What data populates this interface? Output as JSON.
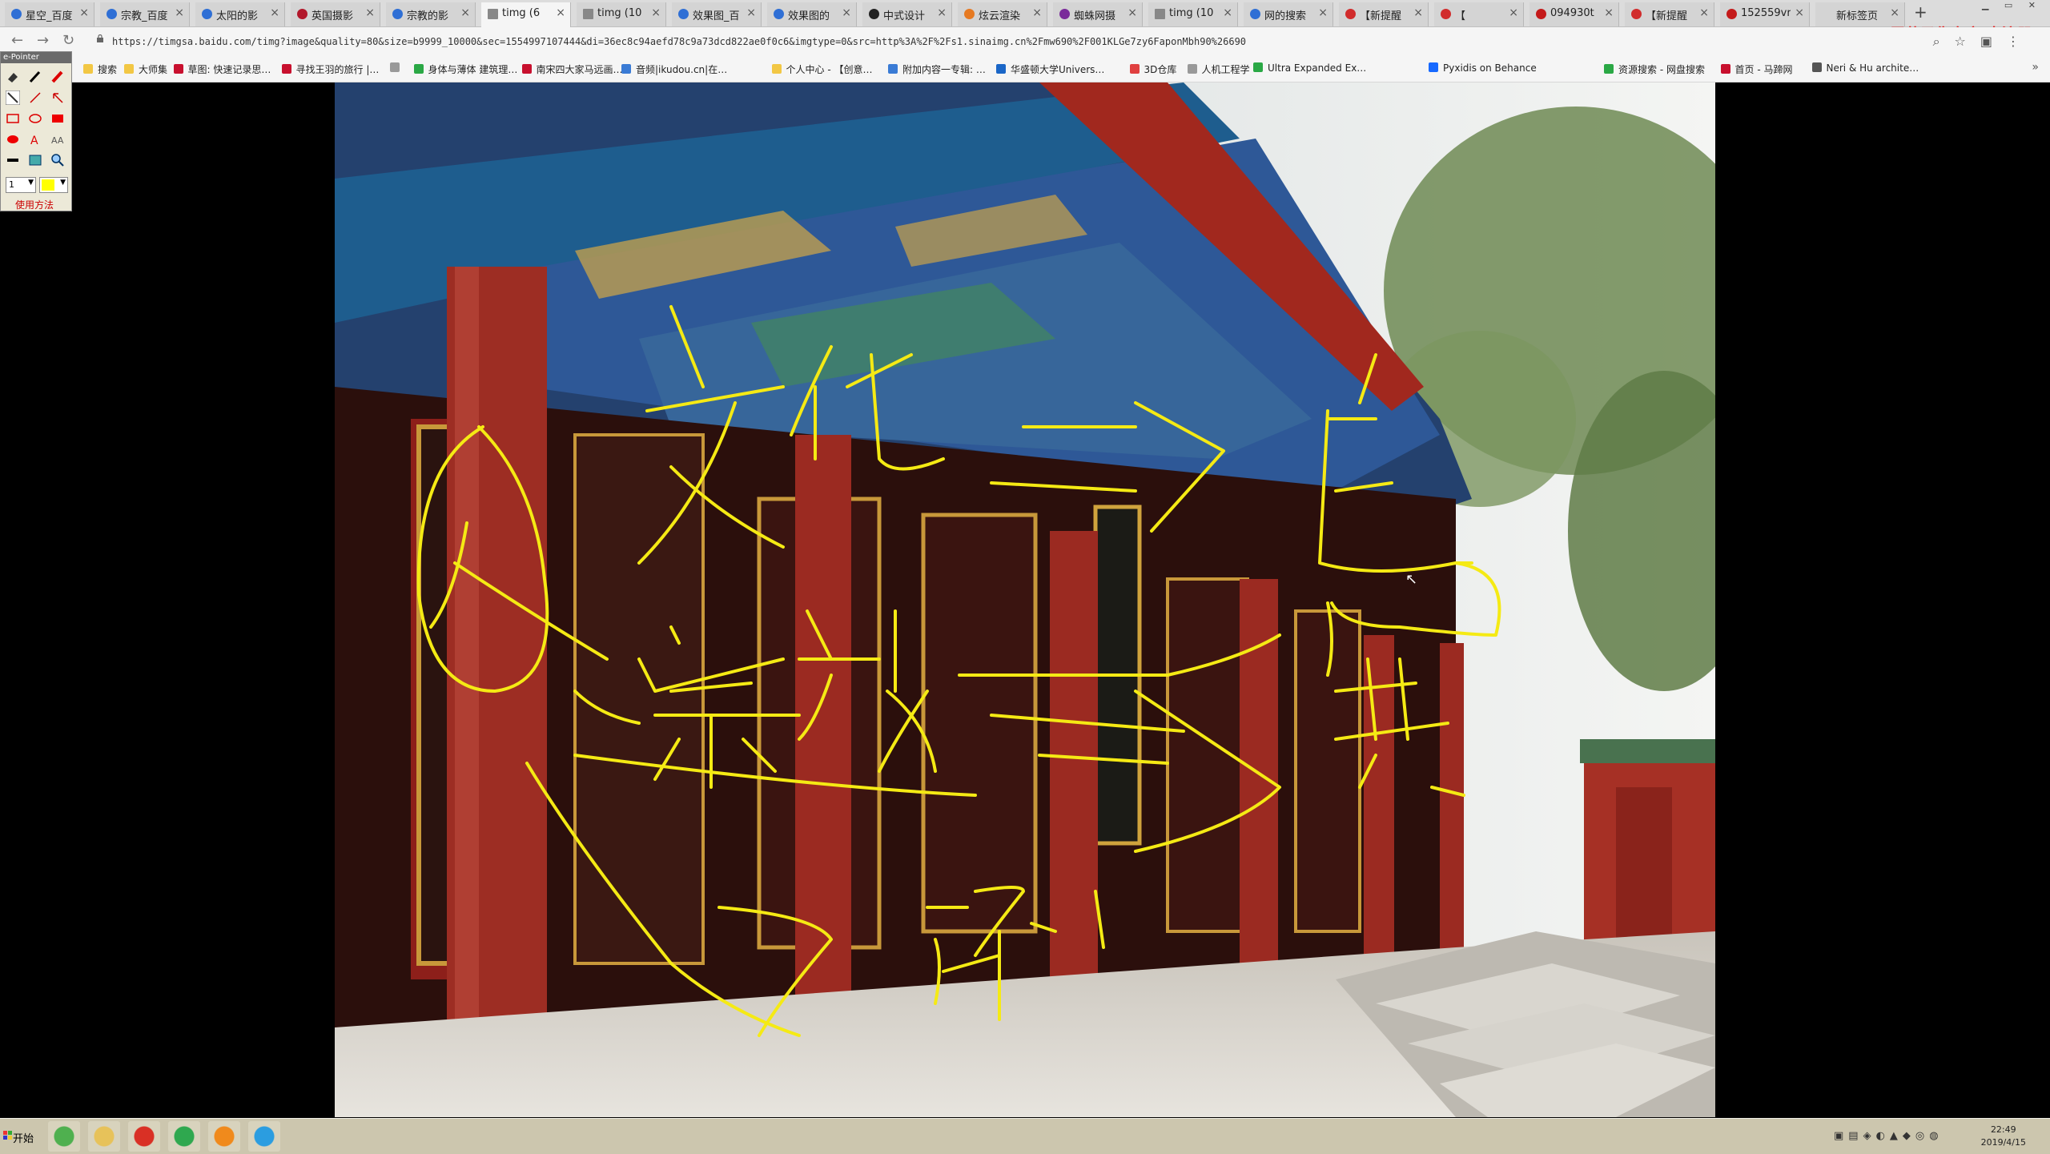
{
  "browser": {
    "tabs": [
      {
        "label": "星空_百度",
        "icon": "baidu-paw-icon",
        "active": false
      },
      {
        "label": "宗教_百度",
        "icon": "baidu-paw-icon",
        "active": false
      },
      {
        "label": "太阳的影",
        "icon": "baidu-paw-icon",
        "active": false
      },
      {
        "label": "英国摄影",
        "icon": "red-site-icon",
        "active": false
      },
      {
        "label": "宗教的影",
        "icon": "baidu-paw-icon",
        "active": false
      },
      {
        "label": "timg (6",
        "icon": "document-icon",
        "active": true
      },
      {
        "label": "timg (10",
        "icon": "document-icon",
        "active": false
      },
      {
        "label": "效果图_百",
        "icon": "baidu-paw-icon",
        "active": false
      },
      {
        "label": "效果图的",
        "icon": "baidu-paw-icon",
        "active": false
      },
      {
        "label": "中式设计",
        "icon": "black-circle-icon",
        "active": false
      },
      {
        "label": "炫云渲染",
        "icon": "orange-site-icon",
        "active": false
      },
      {
        "label": "蜘蛛网摄",
        "icon": "purple-site-icon",
        "active": false
      },
      {
        "label": "timg (10",
        "icon": "document-icon",
        "active": false
      },
      {
        "label": "网的搜索",
        "icon": "baidu-paw-icon",
        "active": false
      },
      {
        "label": "【新提醒",
        "icon": "red-v-icon",
        "active": false
      },
      {
        "label": "【",
        "icon": "red-v-icon",
        "active": false
      },
      {
        "label": "094930t",
        "icon": "red-m-icon",
        "active": false
      },
      {
        "label": "【新提醒",
        "icon": "red-v-icon",
        "active": false
      },
      {
        "label": "152559vr",
        "icon": "red-m-icon",
        "active": false
      },
      {
        "label": "新标签页",
        "icon": "",
        "active": false
      }
    ],
    "new_tab_glyph": "+",
    "url": "https://timgsa.baidu.com/timg?image&quality=80&size=b9999_10000&sec=1554997107444&di=36ec8c94aefd78c9a73dcd822ae0f0c6&imgtype=0&src=http%3A%2F%2Fs1.sinaimg.cn%2Fmw690%2F001KLGe7zy6FaponMbh90%26690",
    "bookmarks": [
      {
        "label": "搜索",
        "color": "#f2c744"
      },
      {
        "label": "大师集",
        "color": "#f2c744"
      },
      {
        "label": "草图: 快速记录思…",
        "color": "#c8102e"
      },
      {
        "label": "寻找王羽的旅行 |…",
        "color": "#c8102e"
      },
      {
        "label": "",
        "color": "#999999"
      },
      {
        "label": "身体与薄体 建筑理…",
        "color": "#2aa845"
      },
      {
        "label": "南宋四大家马远画…",
        "color": "#c8102e"
      },
      {
        "label": "音频|ikudou.cn|在…",
        "color": "#3a7bd5"
      },
      {
        "label": "个人中心 - 【创意…",
        "color": "#f2c744"
      },
      {
        "label": "附加内容一专辑: …",
        "color": "#3a7bd5"
      },
      {
        "label": "华盛顿大学Univers…",
        "color": "#1a66c7"
      },
      {
        "label": "3D仓库",
        "color": "#e04040"
      },
      {
        "label": "人机工程学",
        "color": "#999999"
      },
      {
        "label": "Ultra Expanded Ex…",
        "color": "#2aa845"
      },
      {
        "label": "Pyxidis on Behance",
        "color": "#1769ff"
      },
      {
        "label": "资源搜索 - 网盘搜索",
        "color": "#2aa845"
      },
      {
        "label": "首页 - 马蹄网",
        "color": "#c8102e"
      },
      {
        "label": "Neri & Hu archite…",
        "color": "#555555"
      }
    ],
    "bookmarks_more": "»"
  },
  "watermark": "屏幕录像专家 未注册",
  "ink_annotations": {
    "top": "文化",
    "right_top": "自",
    "middle": "宗教",
    "right_middle": "其",
    "bottom": "环",
    "stroke_color": "#f5ea14"
  },
  "epointer": {
    "title": "e-Pointer",
    "size_value": "1",
    "color_swatch": "#ffff00",
    "help_label": "使用方法"
  },
  "taskbar": {
    "start_label": "开始",
    "apps": [
      "windows-color-icon",
      "file-explorer-icon",
      "chrome-icon",
      "360-browser-icon",
      "vlc-icon",
      "media-player-icon"
    ],
    "clock_time": "22:49",
    "clock_date": "2019/4/15"
  }
}
